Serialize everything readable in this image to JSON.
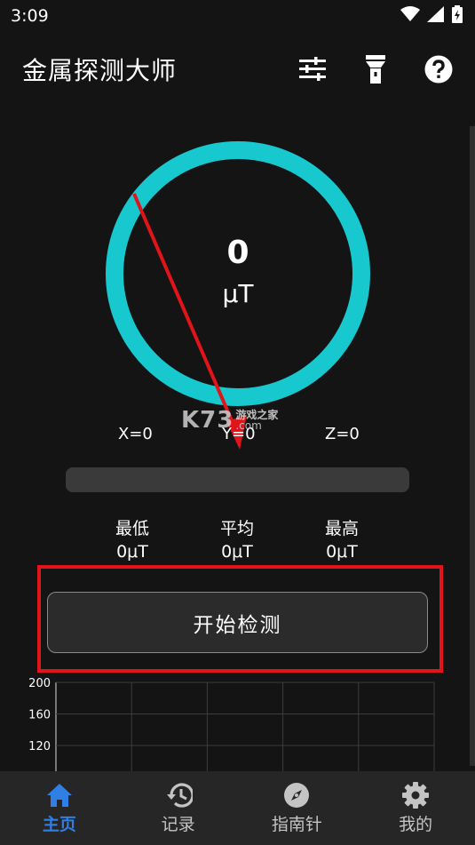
{
  "status_bar": {
    "time": "3:09"
  },
  "app_bar": {
    "title": "金属探测大师",
    "actions": [
      "tune-icon",
      "flashlight-icon",
      "help-icon"
    ]
  },
  "gauge": {
    "value": "0",
    "unit": "μT",
    "ring_color": "#17c9cf",
    "needle_color": "#e0141a"
  },
  "axes": {
    "x": "X=0",
    "y": "Y=0",
    "z": "Z=0"
  },
  "watermark": {
    "logo": "K73",
    "site": "游戏之家",
    "domain": ".com"
  },
  "progress": {
    "level": 0
  },
  "stats": {
    "min": {
      "label": "最低",
      "value": "0μT"
    },
    "avg": {
      "label": "平均",
      "value": "0μT"
    },
    "max": {
      "label": "最高",
      "value": "0μT"
    }
  },
  "start_button": {
    "label": "开始检测"
  },
  "chart_data": {
    "type": "line",
    "x": [],
    "series": [],
    "ytick_labels": [
      "200",
      "160",
      "120"
    ],
    "grid": true
  },
  "bottom_nav": {
    "items": [
      {
        "label": "主页",
        "icon": "home-icon",
        "active": true
      },
      {
        "label": "记录",
        "icon": "history-icon",
        "active": false
      },
      {
        "label": "指南针",
        "icon": "compass-icon",
        "active": false
      },
      {
        "label": "我的",
        "icon": "settings-icon",
        "active": false
      }
    ],
    "active_color": "#2f7fe6"
  }
}
